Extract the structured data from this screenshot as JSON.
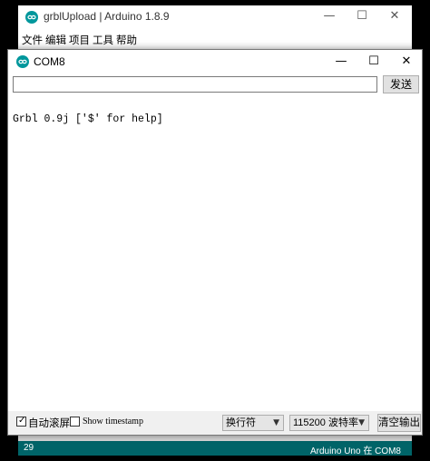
{
  "ide": {
    "title": "grblUpload | Arduino 1.8.9",
    "menu": [
      "文件",
      "编辑",
      "项目",
      "工具",
      "帮助"
    ],
    "status_line": "29",
    "status_board": "Arduino Uno 在 COM8"
  },
  "window_controls": {
    "minimize": "—",
    "maximize": "☐",
    "close": "✕"
  },
  "serial_monitor": {
    "title": "COM8",
    "send_input_value": "",
    "send_label": "发送",
    "output": "Grbl 0.9j ['$' for help]",
    "autoscroll_label": "自动滚屏",
    "autoscroll_checked": "✓",
    "timestamp_label": "Show timestamp",
    "line_ending": "换行符",
    "baud_rate": "115200 波特率",
    "clear_label": "清空输出"
  },
  "colors": {
    "arduino_teal": "#00979c",
    "toolbar_dark_teal": "#006468"
  },
  "icons": [
    "arduino-logo-icon",
    "minimize-icon",
    "maximize-icon",
    "close-icon",
    "checkbox-icon",
    "chevron-down-icon"
  ]
}
